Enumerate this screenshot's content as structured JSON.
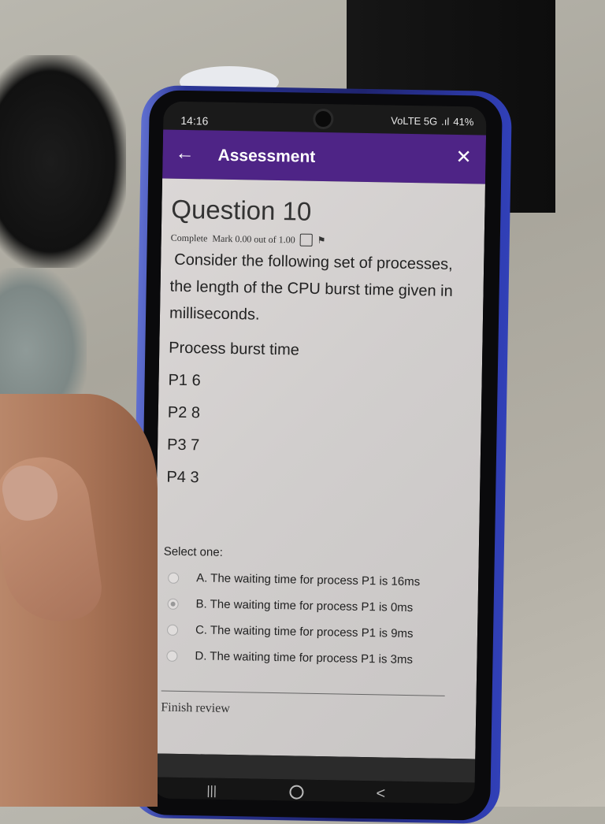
{
  "status_bar": {
    "time": "14:16",
    "network": "VoLTE 5G",
    "signal": ".ıl",
    "battery": "41%"
  },
  "app_bar": {
    "title": "Assessment",
    "back_icon": "arrow-left-icon",
    "close_icon": "close-icon"
  },
  "question": {
    "title": "Question 10",
    "state": "Complete",
    "mark": "Mark 0.00 out of 1.00",
    "text": "Consider the following set of processes, the length of the CPU burst time given in milliseconds.",
    "table_header": "Process burst time",
    "rows": [
      "P1 6",
      "P2 8",
      "P3 7",
      "P4 3"
    ],
    "select_label": "Select one:",
    "options": [
      {
        "label": "A. The waiting time for process P1 is 16ms",
        "selected": false
      },
      {
        "label": "B. The waiting time for process P1 is 0ms",
        "selected": true
      },
      {
        "label": "C. The waiting time for process P1 is 9ms",
        "selected": false
      },
      {
        "label": "D. The waiting time for process P1 is 3ms",
        "selected": false
      }
    ],
    "finish_review": "Finish review"
  },
  "nav_bar": {
    "recent": "|||",
    "back": "<"
  },
  "colors": {
    "app_bar": "#4e2486",
    "content_bg": "#d6d3d2"
  }
}
